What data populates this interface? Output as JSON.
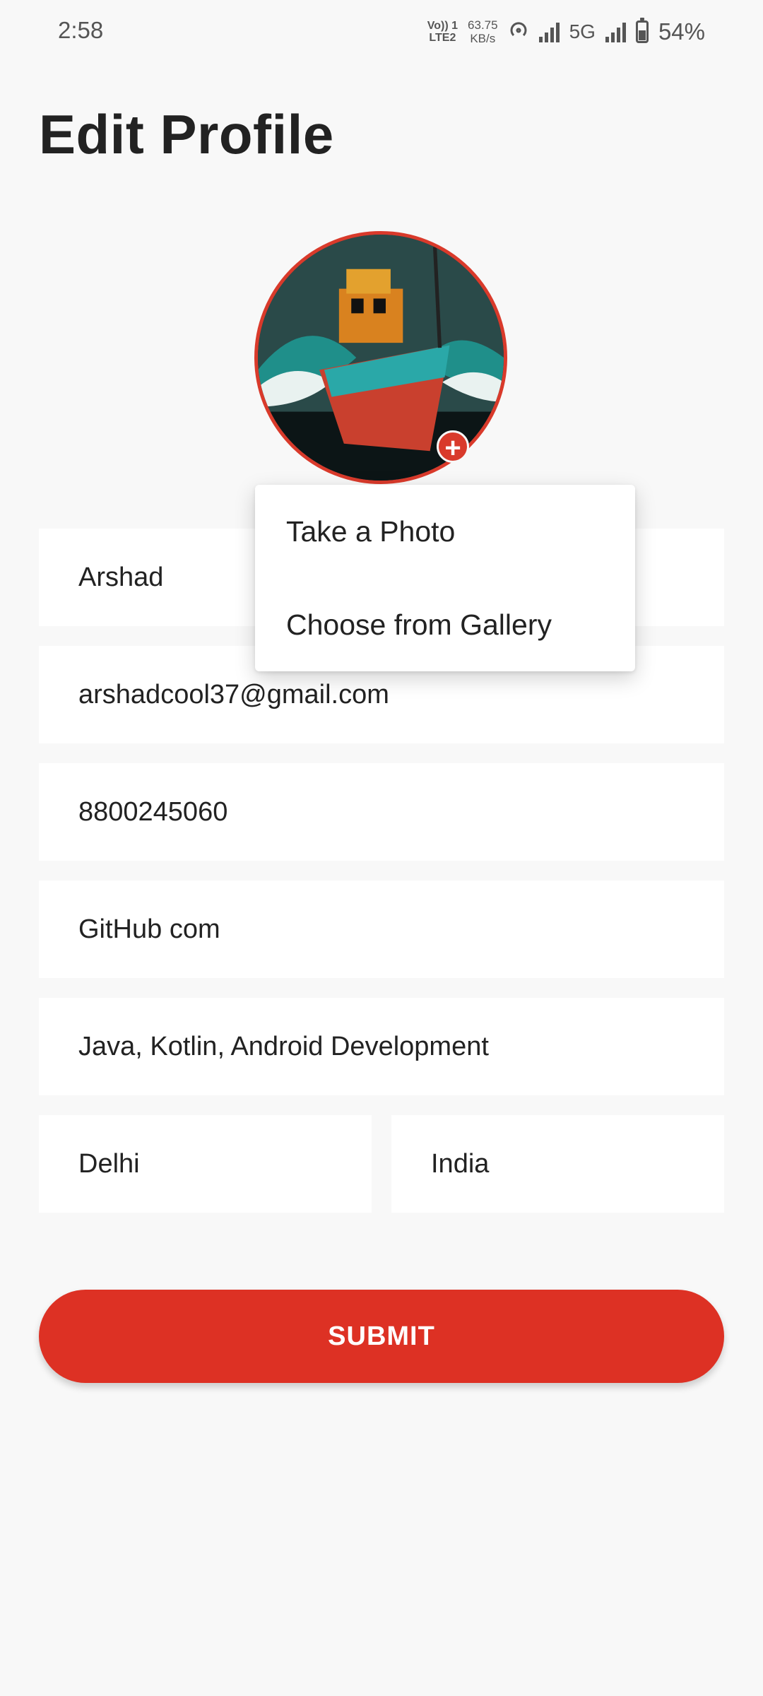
{
  "status_bar": {
    "time": "2:58",
    "volte_top": "Vo)) 1",
    "volte_bottom": "LTE2",
    "speed_value": "63.75",
    "speed_unit": "KB/s",
    "network": "5G",
    "battery": "54%",
    "battery_level": 0.54
  },
  "title": "Edit Profile",
  "avatar": {
    "add_icon": "plus-icon",
    "add_label": "+"
  },
  "fields": {
    "name": "Arshad",
    "email": "arshadcool37@gmail.com",
    "phone": "8800245060",
    "github": "GitHub com",
    "skills": "Java, Kotlin, Android Development",
    "city": "Delhi",
    "country": "India"
  },
  "submit_label": "SUBMIT",
  "menu": {
    "items": [
      "Take a Photo",
      "Choose from Gallery"
    ]
  },
  "colors": {
    "accent": "#dd3124",
    "background": "#f8f8f8"
  }
}
